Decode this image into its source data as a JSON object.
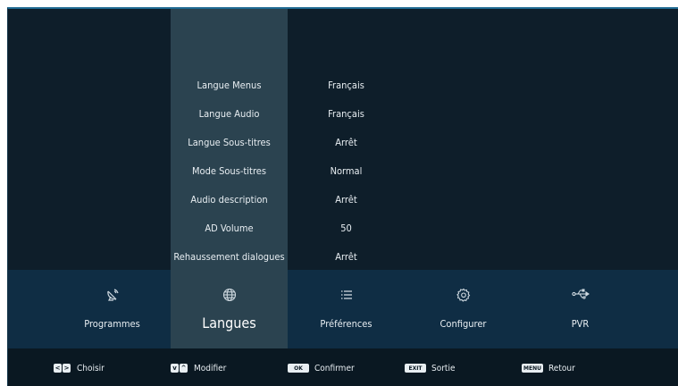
{
  "settings": {
    "rows": [
      {
        "label": "Langue Menus",
        "value": "Français"
      },
      {
        "label": "Langue Audio",
        "value": "Français"
      },
      {
        "label": "Langue Sous-titres",
        "value": "Arrêt"
      },
      {
        "label": "Mode Sous-titres",
        "value": "Normal"
      },
      {
        "label": "Audio description",
        "value": "Arrêt"
      },
      {
        "label": "AD Volume",
        "value": "50"
      },
      {
        "label": "Rehaussement dialogues",
        "value": "Arrêt"
      }
    ]
  },
  "categories": [
    {
      "label": "Programmes",
      "icon": "satellite-dish-icon",
      "active": false
    },
    {
      "label": "Langues",
      "icon": "globe-icon",
      "active": true
    },
    {
      "label": "Préférences",
      "icon": "list-icon",
      "active": false
    },
    {
      "label": "Configurer",
      "icon": "gear-icon",
      "active": false
    },
    {
      "label": "PVR",
      "icon": "usb-icon",
      "active": false
    }
  ],
  "hints": [
    {
      "keys": [
        "<",
        ">"
      ],
      "label": "Choisir"
    },
    {
      "keys": [
        "v",
        "^"
      ],
      "label": "Modifier"
    },
    {
      "keys": [
        "OK"
      ],
      "label": "Confirmer"
    },
    {
      "keys": [
        "EXIT"
      ],
      "label": "Sortie"
    },
    {
      "keys": [
        "MENU"
      ],
      "label": "Retour"
    }
  ],
  "colors": {
    "background": "#0e1e2a",
    "active_column": "#2b4350",
    "category_bar": "#0f2d44",
    "hint_bar": "#0a1822",
    "text": "#e8eef2"
  }
}
